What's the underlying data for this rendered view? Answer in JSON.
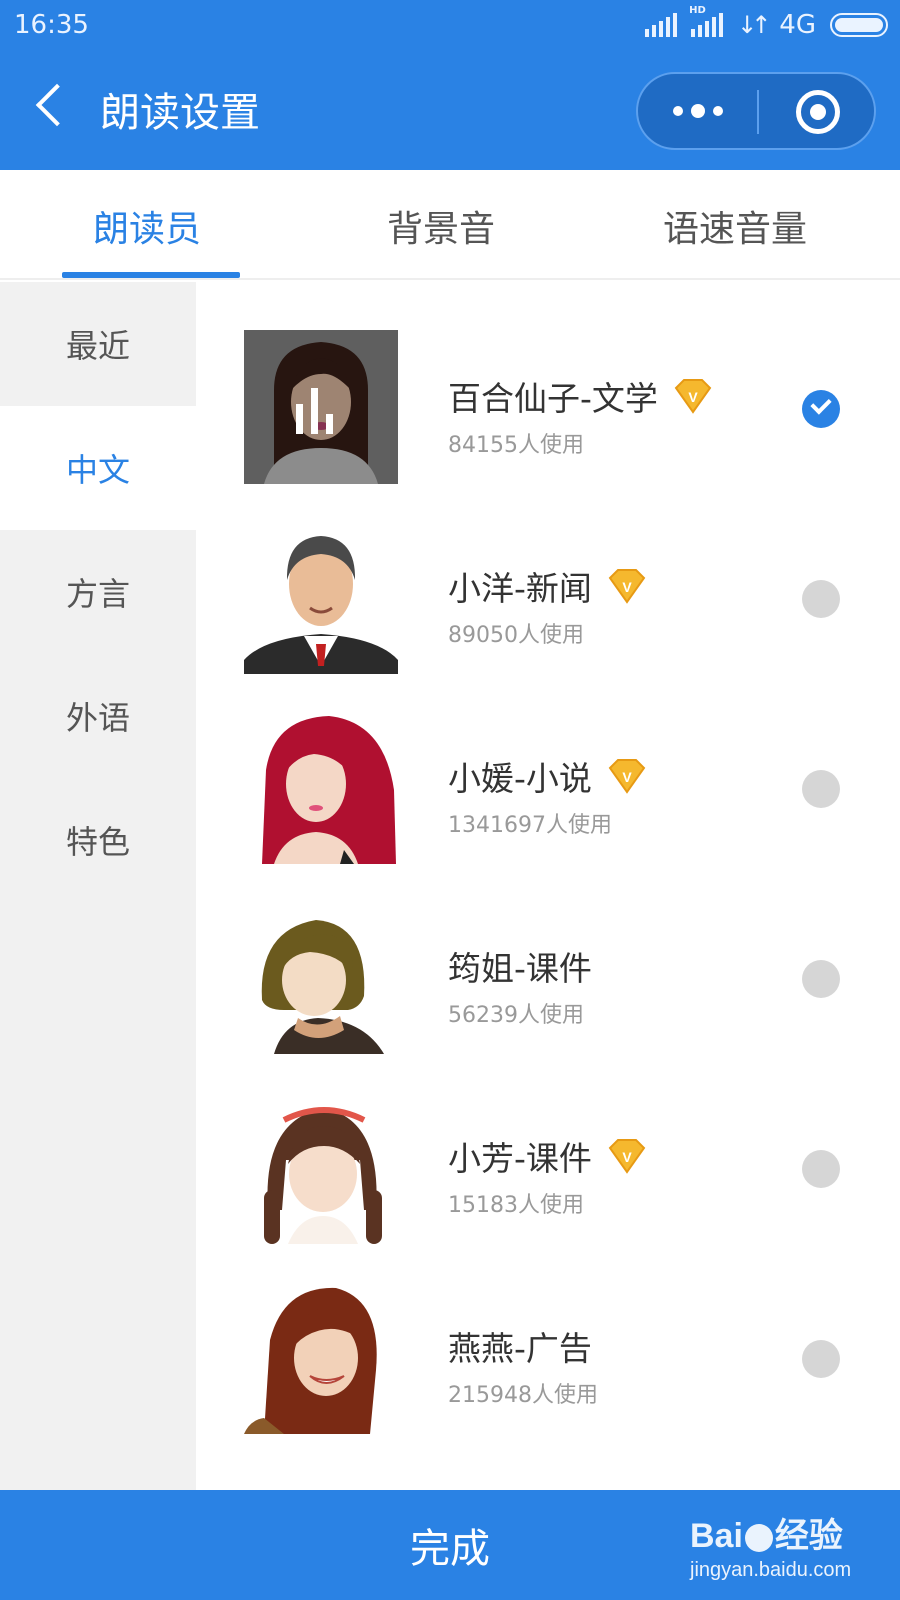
{
  "status_bar": {
    "time": "16:35",
    "hd_label": "HD",
    "network": "4G"
  },
  "nav": {
    "back_icon": "chevron-left-icon",
    "title": "朗读设置",
    "more_icon": "more-dots-icon",
    "target_icon": "record-target-icon"
  },
  "tabs": [
    {
      "label": "朗读员",
      "active": true
    },
    {
      "label": "背景音",
      "active": false
    },
    {
      "label": "语速音量",
      "active": false
    }
  ],
  "sidebar": {
    "items": [
      {
        "label": "最近",
        "active": false
      },
      {
        "label": "中文",
        "active": true
      },
      {
        "label": "方言",
        "active": false
      },
      {
        "label": "外语",
        "active": false
      },
      {
        "label": "特色",
        "active": false
      }
    ]
  },
  "voices": [
    {
      "name": "百合仙子-文学",
      "usage": "84155人使用",
      "vip": true,
      "selected": true,
      "playing": true
    },
    {
      "name": "小洋-新闻",
      "usage": "89050人使用",
      "vip": true,
      "selected": false,
      "playing": false
    },
    {
      "name": "小媛-小说",
      "usage": "1341697人使用",
      "vip": true,
      "selected": false,
      "playing": false
    },
    {
      "name": "筠姐-课件",
      "usage": "56239人使用",
      "vip": false,
      "selected": false,
      "playing": false
    },
    {
      "name": "小芳-课件",
      "usage": "15183人使用",
      "vip": true,
      "selected": false,
      "playing": false
    },
    {
      "name": "燕燕-广告",
      "usage": "215948人使用",
      "vip": false,
      "selected": false,
      "playing": false
    }
  ],
  "bottom": {
    "done_label": "完成",
    "watermark_brand_a": "Bai",
    "watermark_brand_b": "经验",
    "watermark_url": "jingyan.baidu.com"
  },
  "colors": {
    "accent": "#2a82e4",
    "sidebar_bg": "#f1f1f1",
    "radio_off": "#d6d6d6",
    "vip_gold": "#f5b82e"
  }
}
